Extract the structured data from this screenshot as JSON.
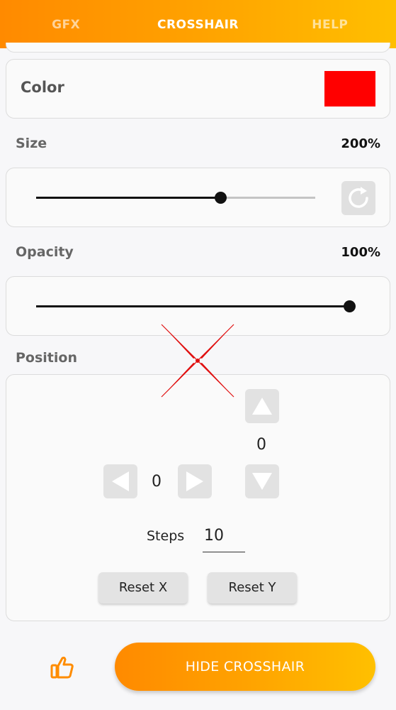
{
  "tabs": [
    {
      "label": "GFX",
      "active": false
    },
    {
      "label": "CROSSHAIR",
      "active": true
    },
    {
      "label": "HELP",
      "active": false
    }
  ],
  "color": {
    "label": "Color",
    "value_hex": "#ff0000"
  },
  "size": {
    "label": "Size",
    "value_text": "200%",
    "slider_fraction": 0.66
  },
  "opacity": {
    "label": "Opacity",
    "value_text": "100%",
    "slider_fraction": 1.0
  },
  "position": {
    "label": "Position",
    "y_value": "0",
    "x_value": "0",
    "steps_label": "Steps",
    "steps_value": "10",
    "reset_x_label": "Reset X",
    "reset_y_label": "Reset Y"
  },
  "crosshair": {
    "color_hex": "#e01010"
  },
  "bottom": {
    "hide_button_label": "HIDE CROSSHAIR"
  },
  "colors": {
    "accent": "#ff9800",
    "track": "#c4c4c4",
    "button_bg": "#e2e2e2"
  }
}
